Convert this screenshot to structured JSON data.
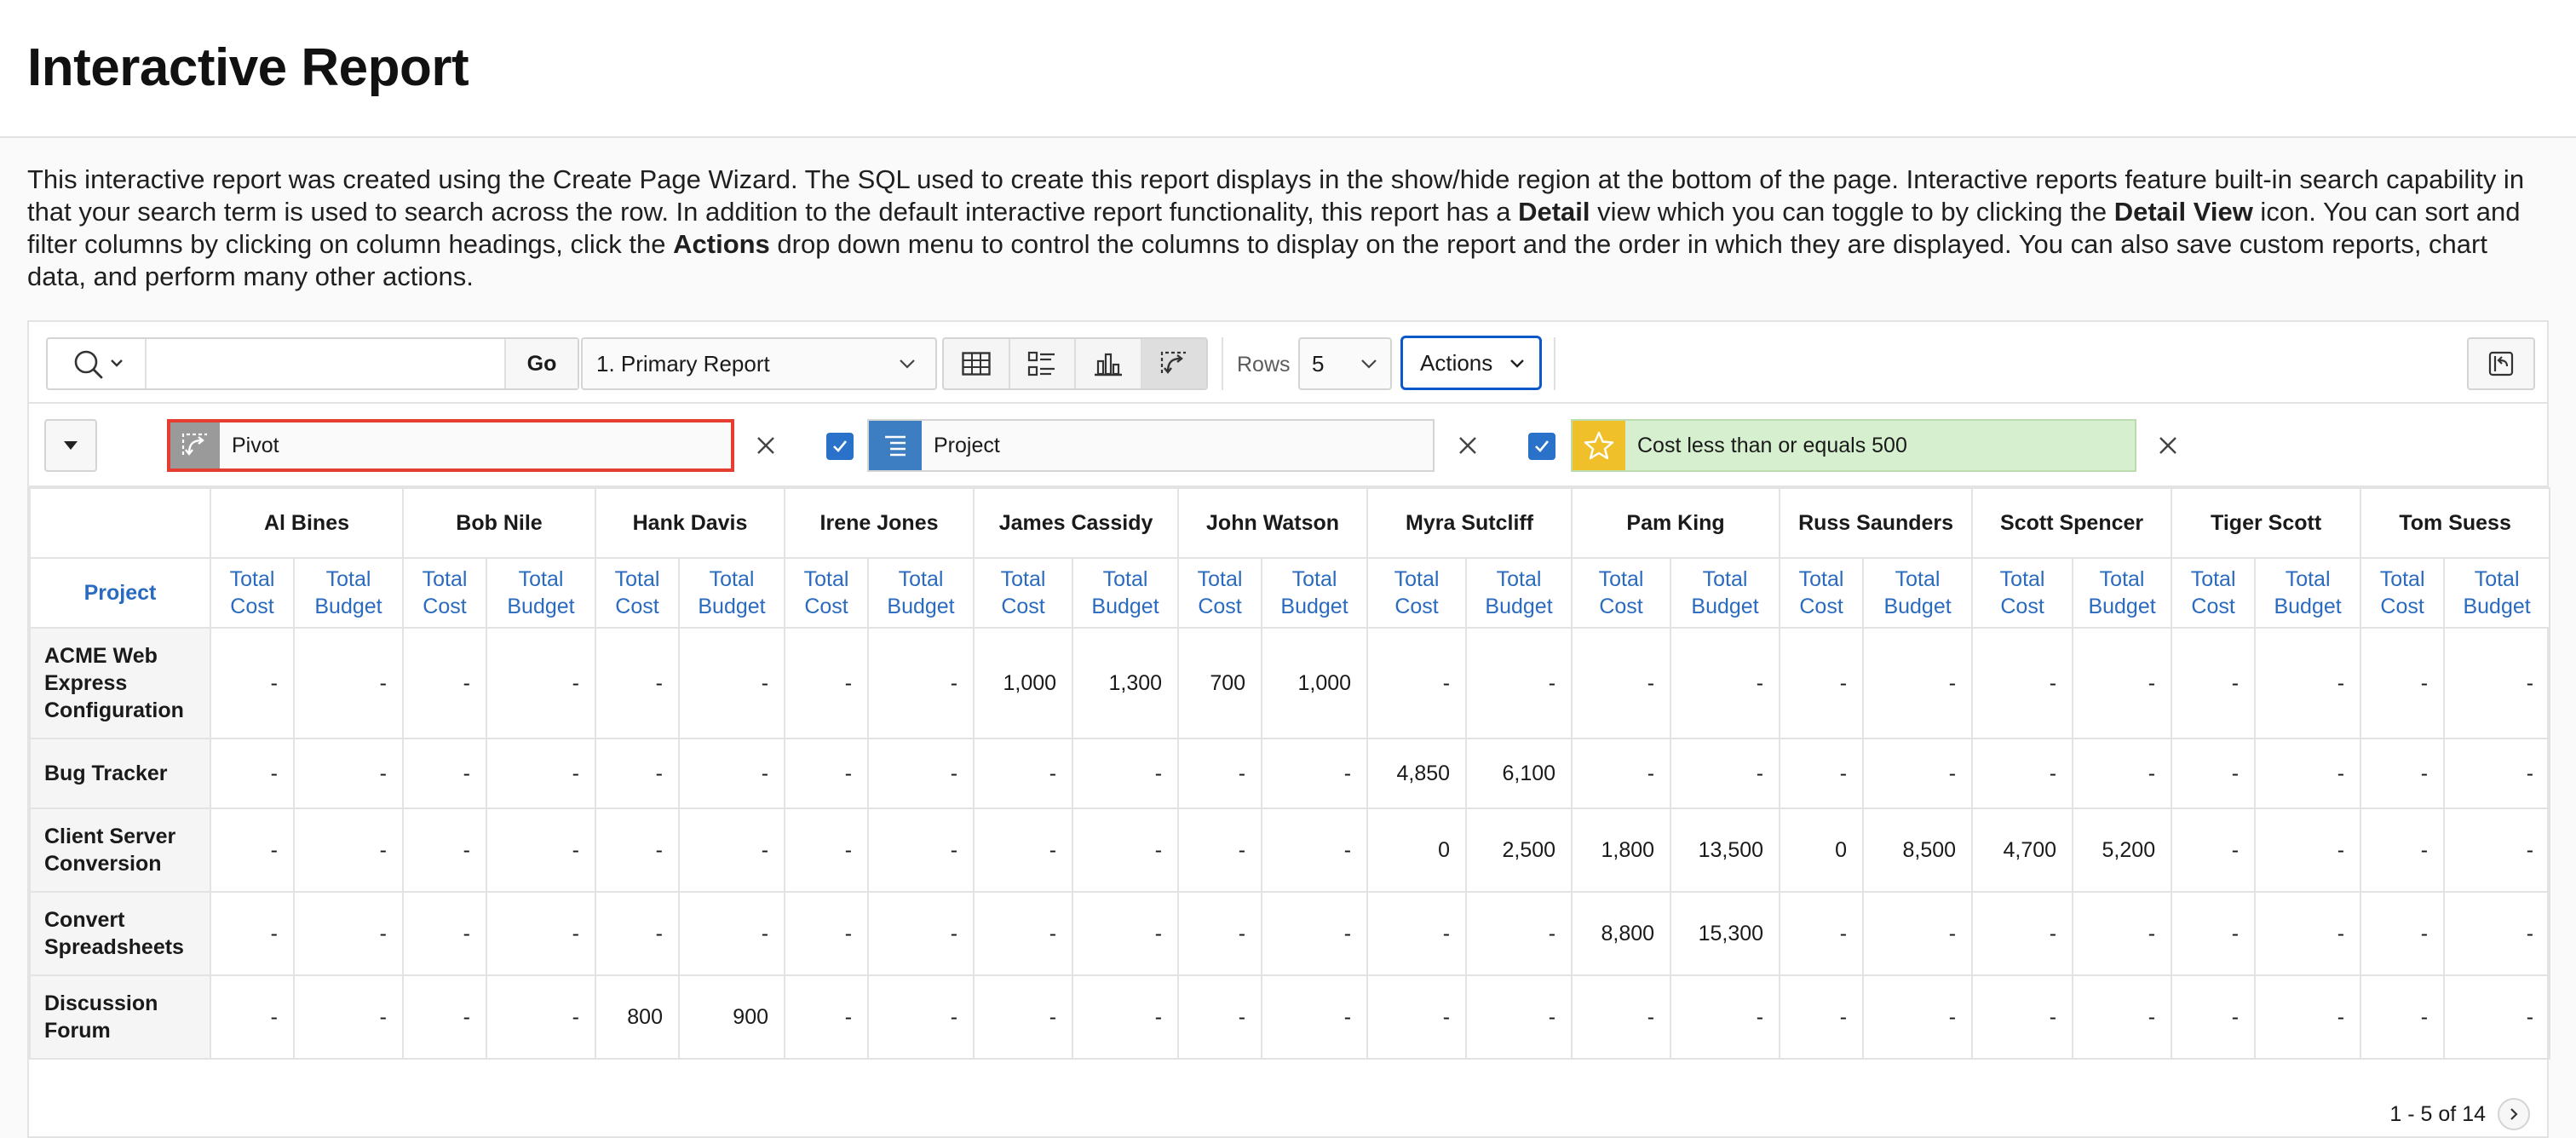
{
  "page": {
    "title": "Interactive Report",
    "description_parts": [
      "This interactive report was created using the Create Page Wizard. The SQL used to create this report displays in the show/hide region at the bottom of the page. Interactive reports feature built-in search capability in that your search term is used to search across the row. In addition to the default interactive report functionality, this report has a ",
      "Detail",
      " view which you can toggle to by clicking the ",
      "Detail View",
      " icon. You can sort and filter columns by clicking on column headings, click the ",
      "Actions",
      " drop down menu to control the columns to display on the report and the order in which they are displayed. You can also save custom reports, chart data, and perform many other actions."
    ]
  },
  "toolbar": {
    "search_icon": "search-icon",
    "search_placeholder": "",
    "go_label": "Go",
    "report_select": "1. Primary Report",
    "views": [
      "table-view-icon",
      "detail-view-icon",
      "chart-view-icon",
      "pivot-view-icon"
    ],
    "rows_label": "Rows",
    "rows_value": "5",
    "actions_label": "Actions"
  },
  "filters": {
    "pivot_label": "Pivot",
    "project_label": "Project",
    "highlight_label": "Cost less than or equals 500",
    "colors": {
      "pivot_border": "#e53e30",
      "highlight_bg": "#d6efce",
      "star": "#f0c02a",
      "project_icon": "#3d7ec2"
    }
  },
  "table": {
    "row_header_label": "Project",
    "sub_headers": [
      "Total\nCost",
      "Total\nBudget"
    ],
    "groups": [
      "Al Bines",
      "Bob Nile",
      "Hank Davis",
      "Irene Jones",
      "James Cassidy",
      "John Watson",
      "Myra Sutcliff",
      "Pam King",
      "Russ Saunders",
      "Scott Spencer",
      "Tiger Scott",
      "Tom Suess"
    ],
    "rows": [
      {
        "project": "ACME Web Express Configuration",
        "cells": [
          "-",
          "-",
          "-",
          "-",
          "-",
          "-",
          "-",
          "-",
          "1,000",
          "1,300",
          "700",
          "1,000",
          "-",
          "-",
          "-",
          "-",
          "-",
          "-",
          "-",
          "-",
          "-",
          "-",
          "-",
          "-"
        ]
      },
      {
        "project": "Bug Tracker",
        "cells": [
          "-",
          "-",
          "-",
          "-",
          "-",
          "-",
          "-",
          "-",
          "-",
          "-",
          "-",
          "-",
          "4,850",
          "6,100",
          "-",
          "-",
          "-",
          "-",
          "-",
          "-",
          "-",
          "-",
          "-",
          "-"
        ]
      },
      {
        "project": "Client Server Conversion",
        "cells": [
          "-",
          "-",
          "-",
          "-",
          "-",
          "-",
          "-",
          "-",
          "-",
          "-",
          "-",
          "-",
          "0",
          "2,500",
          "1,800",
          "13,500",
          "0",
          "8,500",
          "4,700",
          "5,200",
          "-",
          "-",
          "-",
          "-"
        ]
      },
      {
        "project": "Convert Spreadsheets",
        "cells": [
          "-",
          "-",
          "-",
          "-",
          "-",
          "-",
          "-",
          "-",
          "-",
          "-",
          "-",
          "-",
          "-",
          "-",
          "8,800",
          "15,300",
          "-",
          "-",
          "-",
          "-",
          "-",
          "-",
          "-",
          "-"
        ]
      },
      {
        "project": "Discussion Forum",
        "cells": [
          "-",
          "-",
          "-",
          "-",
          "800",
          "900",
          "-",
          "-",
          "-",
          "-",
          "-",
          "-",
          "-",
          "-",
          "-",
          "-",
          "-",
          "-",
          "-",
          "-",
          "-",
          "-",
          "-",
          "-"
        ]
      }
    ]
  },
  "pagination": {
    "text": "1 - 5 of 14"
  }
}
